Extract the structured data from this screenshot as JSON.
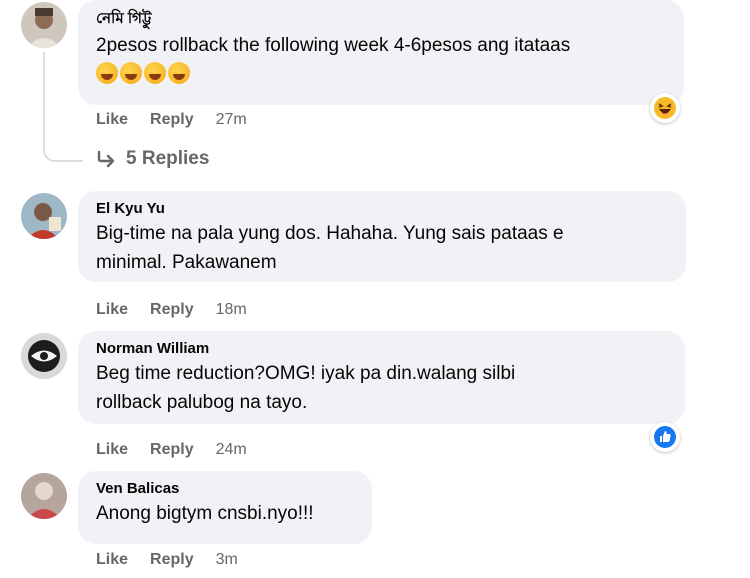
{
  "comments": [
    {
      "author": "নেমি গিট্টু",
      "text": "2pesos rollback the following week 4-6pesos ang itataas",
      "emoji_text": "🤣🤣🤣🤣",
      "like": "Like",
      "reply": "Reply",
      "time": "27m",
      "reaction_icon": "laugh-reaction-icon",
      "replies_label": "5 Replies"
    },
    {
      "author": "El Kyu Yu",
      "text_line1": "Big-time na pala yung dos. Hahaha. Yung sais pataas e",
      "text_line2": "minimal. Pakawanem",
      "like": "Like",
      "reply": "Reply",
      "time": "18m"
    },
    {
      "author": "Norman William",
      "text_line1": "Beg time reduction?OMG! iyak pa din.walang silbi",
      "text_line2": "rollback palubog na tayo.",
      "like": "Like",
      "reply": "Reply",
      "time": "24m",
      "reaction_icon": "like-reaction-icon"
    },
    {
      "author": "Ven Balicas",
      "text": "Anong bigtym cnsbi.nyo!!!",
      "like": "Like",
      "reply": "Reply",
      "time": "3m"
    }
  ],
  "colors": {
    "bubble": "#f0f2f5",
    "meta": "#65676b",
    "like_blue": "#1877f2",
    "haha_yellow": "#f7b928"
  }
}
